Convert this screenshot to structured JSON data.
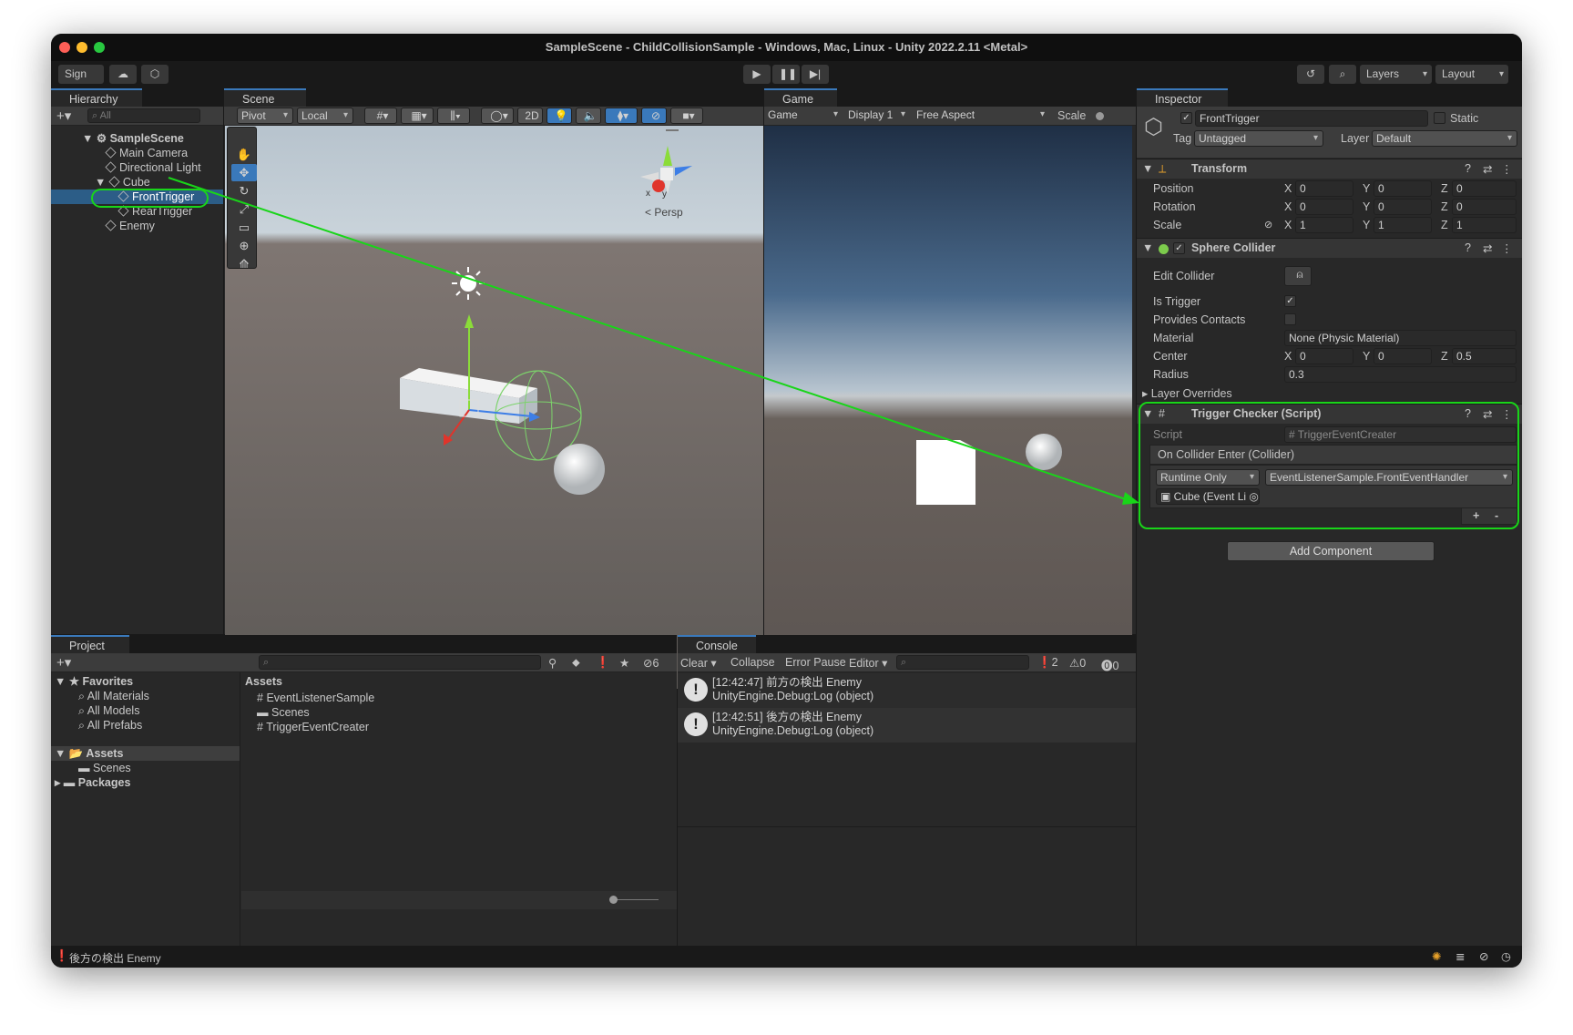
{
  "window": {
    "title": "SampleScene - ChildCollisionSample - Windows, Mac, Linux - Unity 2022.2.11 <Metal>"
  },
  "toolbar": {
    "sign_in": "Sign in",
    "layers": "Layers",
    "layout": "Layout"
  },
  "hierarchy": {
    "tab": "Hierarchy",
    "search": "All",
    "scene": "SampleScene",
    "items": [
      "Main Camera",
      "Directional Light",
      "Cube",
      "FrontTrigger",
      "RearTrigger",
      "Enemy"
    ]
  },
  "scene": {
    "tab": "Scene",
    "pivot": "Pivot",
    "local": "Local",
    "mode2d": "2D",
    "persp": "Persp",
    "axes": {
      "x": "x",
      "y": "y"
    }
  },
  "game": {
    "tab": "Game",
    "mode": "Game",
    "display": "Display 1",
    "aspect": "Free Aspect",
    "scale": "Scale"
  },
  "inspector": {
    "tab": "Inspector",
    "object_name": "FrontTrigger",
    "static": "Static",
    "tag_label": "Tag",
    "tag": "Untagged",
    "layer_label": "Layer",
    "layer": "Default",
    "transform": {
      "title": "Transform",
      "rows": [
        {
          "label": "Position",
          "x": "0",
          "y": "0",
          "z": "0"
        },
        {
          "label": "Rotation",
          "x": "0",
          "y": "0",
          "z": "0"
        },
        {
          "label": "Scale",
          "x": "1",
          "y": "1",
          "z": "1"
        }
      ],
      "x": "X",
      "y": "Y",
      "z": "Z"
    },
    "collider": {
      "title": "Sphere Collider",
      "edit": "Edit Collider",
      "is_trigger": "Is Trigger",
      "provides": "Provides Contacts",
      "material_label": "Material",
      "material": "None (Physic Material)",
      "center_label": "Center",
      "center": {
        "x": "0",
        "y": "0",
        "z": "0.5"
      },
      "radius_label": "Radius",
      "radius": "0.3",
      "overrides": "Layer Overrides"
    },
    "script": {
      "title": "Trigger Checker (Script)",
      "script_label": "Script",
      "script_value": "TriggerEventCreater",
      "event": "On Collider Enter (Collider)",
      "runtime": "Runtime Only",
      "handler": "EventListenerSample.FrontEventHandler",
      "target": "Cube (Event Li",
      "plus": "+",
      "minus": "-"
    },
    "add_component": "Add Component"
  },
  "project": {
    "tab": "Project",
    "favorites": "Favorites",
    "fav_items": [
      "All Materials",
      "All Models",
      "All Prefabs"
    ],
    "assets": "Assets",
    "assets_children": [
      "Scenes"
    ],
    "packages": "Packages",
    "assets_header": "Assets",
    "files": [
      "EventListenerSample",
      "Scenes",
      "TriggerEventCreater"
    ],
    "hidden_count": "6"
  },
  "console": {
    "tab": "Console",
    "clear": "Clear",
    "collapse": "Collapse",
    "error_pause": "Error Pause",
    "editor": "Editor",
    "counts": {
      "info": "2",
      "warn": "0",
      "error": "0"
    },
    "logs": [
      {
        "line1": "[12:42:47] 前方の検出 Enemy",
        "line2": "UnityEngine.Debug:Log (object)"
      },
      {
        "line1": "[12:42:51] 後方の検出 Enemy",
        "line2": "UnityEngine.Debug:Log (object)"
      }
    ]
  },
  "statusbar": {
    "message": "後方の検出 Enemy"
  },
  "colors": {
    "annotation": "#19d519",
    "selection": "#2c5d87",
    "accent": "#3a79bb"
  }
}
